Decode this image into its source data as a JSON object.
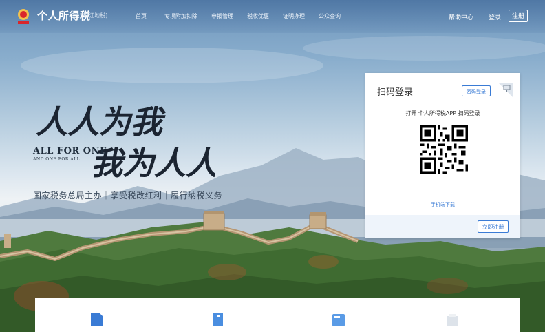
{
  "header": {
    "brand": "个人所得税",
    "region": "[浙江地税]",
    "nav": [
      "首页",
      "专项附加扣除",
      "申报管理",
      "税收优惠",
      "证明办理",
      "公众查询"
    ],
    "help": "帮助中心",
    "login": "登录",
    "register": "注册"
  },
  "hero": {
    "slogan_line1": "人人为我",
    "slogan_line2": "我为人人",
    "english_line1": "ALL FOR ONE",
    "english_line2": "AND ONE FOR ALL",
    "tagline": "国家税务总局主办｜享受税改红利｜履行纳税义务"
  },
  "login_panel": {
    "title": "扫码登录",
    "password_login": "密码登录",
    "scan_hint": "打开 个人所得税APP 扫码登录",
    "download_link": "手机端下载",
    "register_now": "立即注册"
  },
  "colors": {
    "accent": "#3a7bd5",
    "nav_text": "#ffffff",
    "panel_footer": "#eef4fb"
  }
}
